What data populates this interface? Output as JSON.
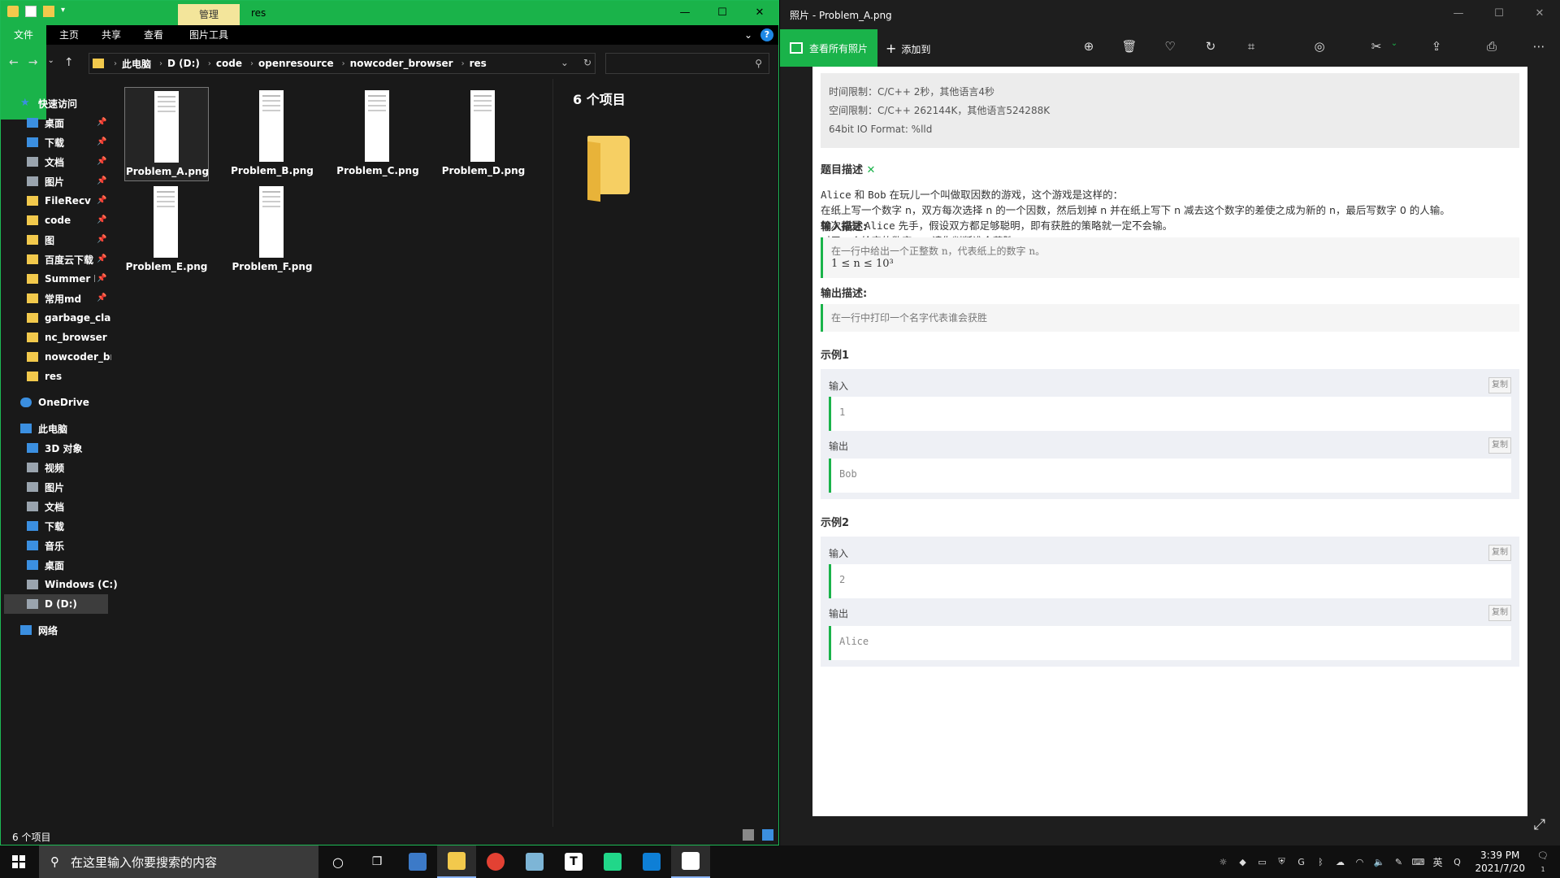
{
  "explorer": {
    "window_title": "res",
    "manage_tab": "管理",
    "ribbon_tabs": [
      "文件",
      "主页",
      "共享",
      "查看",
      "图片工具"
    ],
    "breadcrumbs": [
      "此电脑",
      "D (D:)",
      "code",
      "openresource",
      "nowcoder_browser",
      "res"
    ],
    "nav": {
      "quick_access": "快速访问",
      "quick_items": [
        "桌面",
        "下载",
        "文档",
        "图片",
        "FileRecv",
        "code",
        "图",
        "百度云下载",
        "Summer Pc",
        "常用md",
        "garbage_clas",
        "nc_browser",
        "nowcoder_bro",
        "res"
      ],
      "onedrive": "OneDrive",
      "this_pc": "此电脑",
      "pc_items": [
        "3D 对象",
        "视频",
        "图片",
        "文档",
        "下载",
        "音乐",
        "桌面",
        "Windows (C:)",
        "D (D:)"
      ],
      "network": "网络"
    },
    "files": [
      "Problem_A.png",
      "Problem_B.png",
      "Problem_C.png",
      "Problem_D.png",
      "Problem_E.png",
      "Problem_F.png"
    ],
    "preview_count": "6 个项目",
    "status": "6 个项目"
  },
  "photos": {
    "window_title": "照片 - Problem_A.png",
    "see_all": "查看所有照片",
    "add_to": "添加到",
    "limits": {
      "time": "时间限制：C/C++ 2秒，其他语言4秒",
      "space": "空间限制：C/C++ 262144K，其他语言524288K",
      "io": "64bit IO Format: %lld"
    },
    "desc_title": "题目描述",
    "desc_line1_a": "Alice",
    "desc_line1_b": " 和 ",
    "desc_line1_c": "Bob",
    "desc_line1_d": " 在玩儿一个叫做取因数的游戏，这个游戏是这样的：",
    "desc_line2": "在纸上写一个数字 n，双方每次选择 n 的一个因数，然后划掉 n 并在纸上写下 n 减去这个数字的差使之成为新的 n，最后写数字 0 的人输。",
    "desc_line3_a": "每次都是 ",
    "desc_line3_b": "Alice",
    "desc_line3_c": " 先手，假设双方都足够聪明，即有获胜的策略就一定不会输。",
    "desc_line4": "对于一个给定的数字 n，请你判断谁会获胜。",
    "input_title": "输入描述:",
    "input_text": "在一行中给出一个正整数 n，代表纸上的数字 n。",
    "input_constraint": "1 ≤ n ≤ 10³",
    "output_title": "输出描述:",
    "output_text": "在一行中打印一个名字代表谁会获胜",
    "example1_title": "示例1",
    "example2_title": "示例2",
    "input_label": "输入",
    "output_label": "输出",
    "copy_label": "复制",
    "ex1_in": "1",
    "ex1_out": "Bob",
    "ex2_in": "2",
    "ex2_out": "Alice"
  },
  "taskbar": {
    "search_placeholder": "在这里输入你要搜索的内容",
    "time": "3:39 PM",
    "date": "2021/7/20",
    "ime": "英",
    "notification_count": "1"
  }
}
